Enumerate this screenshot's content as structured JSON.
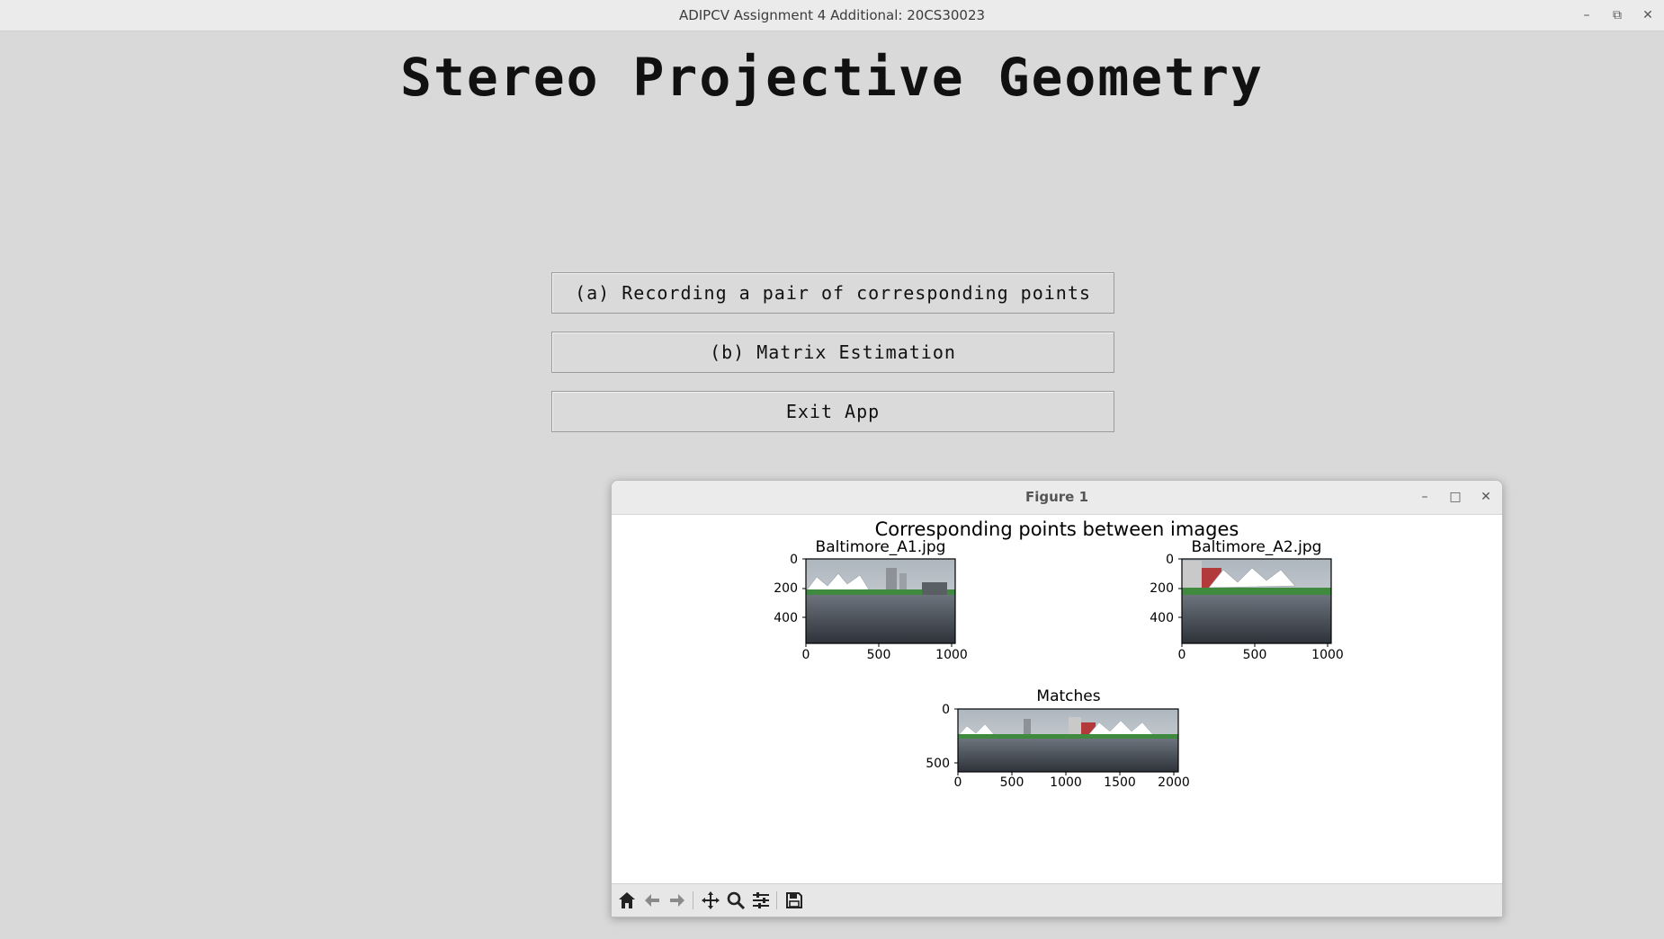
{
  "window": {
    "title": "ADIPCV Assignment 4 Additional: 20CS30023",
    "minimize": "–",
    "restore": "⧉",
    "close": "✕"
  },
  "app": {
    "heading": "Stereo Projective Geometry",
    "buttons": [
      {
        "label": "(a) Recording a pair of corresponding points"
      },
      {
        "label": "(b) Matrix Estimation"
      },
      {
        "label": "Exit App"
      }
    ]
  },
  "figure_window": {
    "title": "Figure 1",
    "minimize": "–",
    "maximize": "□",
    "close": "✕",
    "suptitle": "Corresponding points between images",
    "toolbar": [
      "home-icon",
      "back-icon",
      "forward-icon",
      "pan-icon",
      "zoom-icon",
      "configure-subplots-icon",
      "save-icon"
    ]
  },
  "chart_data": [
    {
      "type": "image",
      "title": "Baltimore_A1.jpg",
      "xticks": [
        0,
        500,
        1000
      ],
      "yticks": [
        0,
        200,
        400
      ],
      "xlim": [
        0,
        1024
      ],
      "ylim": [
        576,
        0
      ]
    },
    {
      "type": "image",
      "title": "Baltimore_A2.jpg",
      "xticks": [
        0,
        500,
        1000
      ],
      "yticks": [
        0,
        200,
        400
      ],
      "xlim": [
        0,
        1024
      ],
      "ylim": [
        576,
        0
      ]
    },
    {
      "type": "image",
      "title": "Matches",
      "xticks": [
        0,
        500,
        1000,
        1500,
        2000
      ],
      "yticks": [
        0,
        500
      ],
      "xlim": [
        0,
        2048
      ],
      "ylim": [
        576,
        0
      ]
    }
  ]
}
